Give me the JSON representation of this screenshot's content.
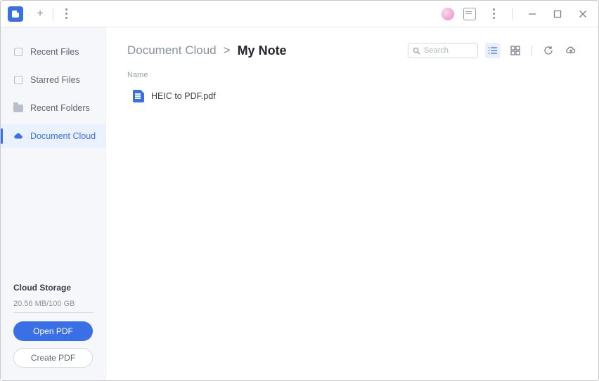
{
  "titlebar": {
    "new_tab_label": "+"
  },
  "sidebar": {
    "items": [
      {
        "label": "Recent Files"
      },
      {
        "label": "Starred Files"
      },
      {
        "label": "Recent Folders"
      },
      {
        "label": "Document Cloud"
      }
    ],
    "storage_title": "Cloud Storage",
    "storage_text": "20.56 MB/100 GB",
    "open_pdf_label": "Open PDF",
    "create_pdf_label": "Create PDF"
  },
  "main": {
    "breadcrumb_root": "Document Cloud",
    "breadcrumb_sep": ">",
    "breadcrumb_current": "My Note",
    "search_placeholder": "Search",
    "column_name": "Name",
    "files": [
      {
        "name": "HEIC to PDF.pdf"
      }
    ]
  }
}
